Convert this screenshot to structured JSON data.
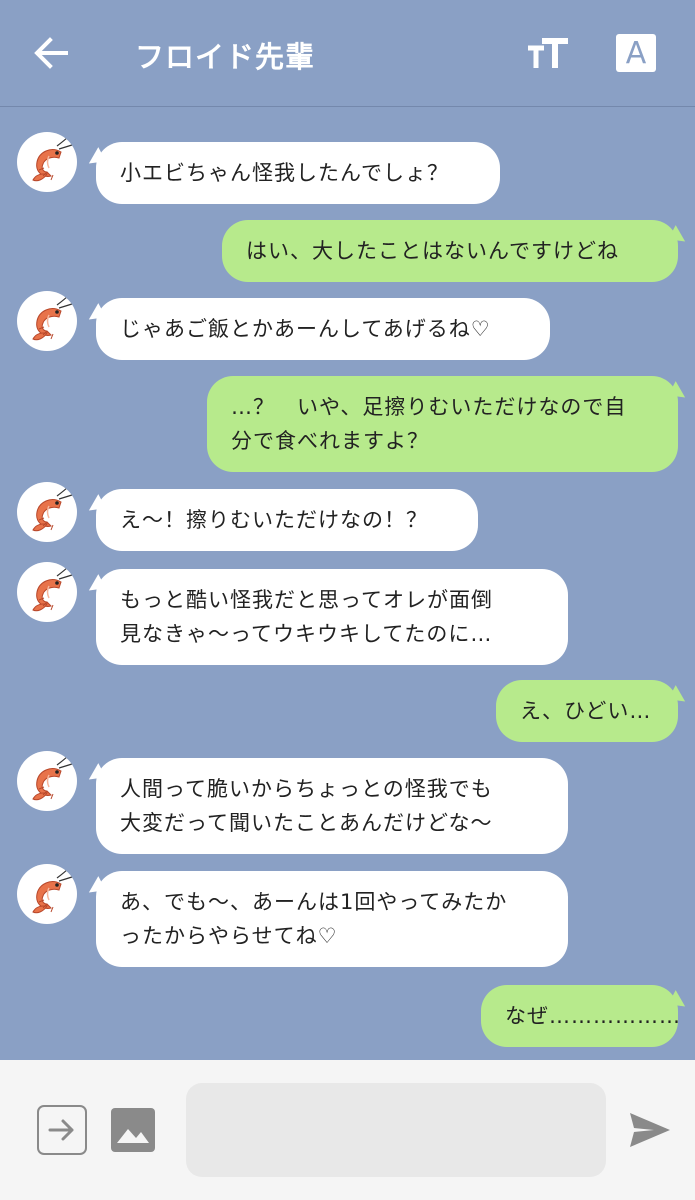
{
  "header": {
    "title": "フロイド先輩",
    "back_icon": "back-arrow-icon",
    "font_size_icon": "font-size-icon",
    "translate_label": "A"
  },
  "messages": [
    {
      "side": "in",
      "lines": [
        "小エビちゃん怪我したんでしょ？"
      ]
    },
    {
      "side": "out",
      "lines": [
        "はい、大したことはないんですけどね"
      ]
    },
    {
      "side": "in",
      "lines": [
        "じゃあご飯とかあーんしてあげるね♡"
      ]
    },
    {
      "side": "out",
      "lines": [
        "…？　いや、足擦りむいただけなので自",
        "分で食べれますよ？"
      ]
    },
    {
      "side": "in",
      "lines": [
        "え〜！擦りむいただけなの！？"
      ]
    },
    {
      "side": "in",
      "lines": [
        "もっと酷い怪我だと思ってオレが面倒",
        "見なきゃ〜ってウキウキしてたのに…"
      ]
    },
    {
      "side": "out",
      "lines": [
        "え、ひどい…"
      ]
    },
    {
      "side": "in",
      "lines": [
        "人間って脆いからちょっとの怪我でも",
        "大変だって聞いたことあんだけどな〜"
      ]
    },
    {
      "side": "in",
      "lines": [
        "あ、でも〜、あーんは1回やってみたか",
        "ったからやらせてね♡"
      ]
    },
    {
      "side": "out",
      "lines": [
        "なぜ………………"
      ]
    }
  ],
  "avatar_icon": "shrimp-icon",
  "input": {
    "value": "",
    "placeholder": ""
  },
  "icons": {
    "attach": "arrow-in-box-icon",
    "image": "image-icon",
    "send": "send-icon"
  },
  "colors": {
    "background": "#8aa0c5",
    "incoming": "#ffffff",
    "outgoing": "#b7ea8c",
    "inputbar": "#f5f5f5"
  }
}
